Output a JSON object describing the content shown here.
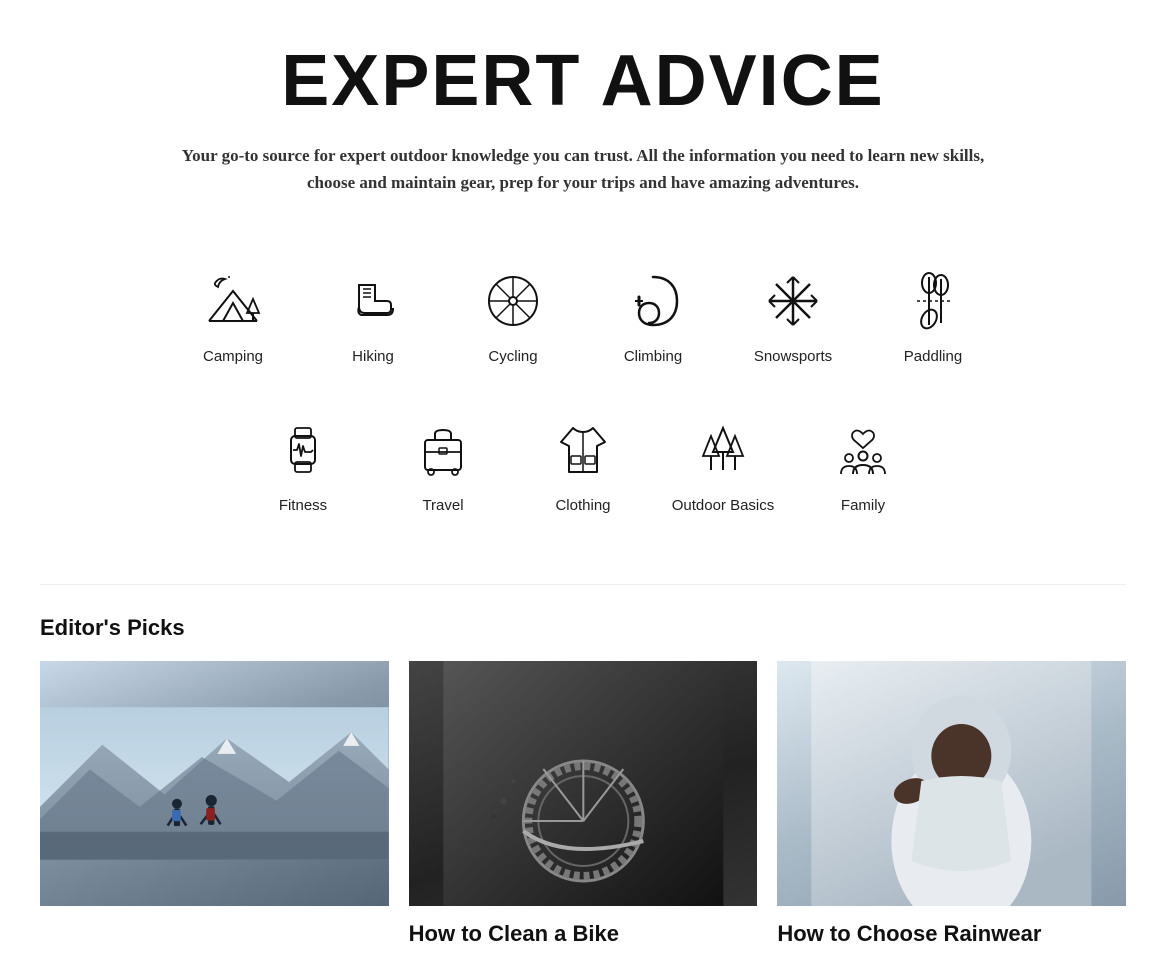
{
  "hero": {
    "title": "EXPERT ADVICE",
    "subtitle": "Your go-to source for expert outdoor knowledge you can trust. All the information you need to learn new skills, choose and maintain gear, prep for your trips and have amazing adventures."
  },
  "categories": {
    "row1": [
      {
        "id": "camping",
        "label": "Camping"
      },
      {
        "id": "hiking",
        "label": "Hiking"
      },
      {
        "id": "cycling",
        "label": "Cycling"
      },
      {
        "id": "climbing",
        "label": "Climbing"
      },
      {
        "id": "snowsports",
        "label": "Snowsports"
      },
      {
        "id": "paddling",
        "label": "Paddling"
      }
    ],
    "row2": [
      {
        "id": "fitness",
        "label": "Fitness"
      },
      {
        "id": "travel",
        "label": "Travel"
      },
      {
        "id": "clothing",
        "label": "Clothing"
      },
      {
        "id": "outdoor-basics",
        "label": "Outdoor Basics"
      },
      {
        "id": "family",
        "label": "Family"
      }
    ]
  },
  "editors_picks": {
    "section_title": "Editor's Picks",
    "cards": [
      {
        "id": "hikers",
        "title": "",
        "img_alt": "Two hikers looking at mountain view"
      },
      {
        "id": "bike",
        "title": "How to Clean a Bike",
        "img_alt": "Close-up of bike gears"
      },
      {
        "id": "rainwear",
        "title": "How to Choose Rainwear",
        "img_alt": "Person in white rainwear"
      }
    ]
  }
}
